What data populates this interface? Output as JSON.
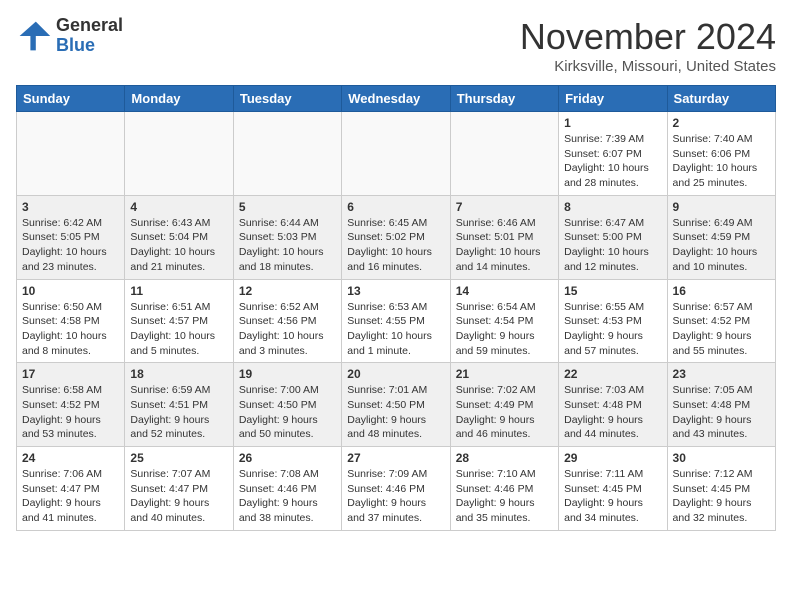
{
  "header": {
    "logo_general": "General",
    "logo_blue": "Blue",
    "month_title": "November 2024",
    "location": "Kirksville, Missouri, United States"
  },
  "weekdays": [
    "Sunday",
    "Monday",
    "Tuesday",
    "Wednesday",
    "Thursday",
    "Friday",
    "Saturday"
  ],
  "weeks": [
    [
      {
        "day": "",
        "info": ""
      },
      {
        "day": "",
        "info": ""
      },
      {
        "day": "",
        "info": ""
      },
      {
        "day": "",
        "info": ""
      },
      {
        "day": "",
        "info": ""
      },
      {
        "day": "1",
        "info": "Sunrise: 7:39 AM\nSunset: 6:07 PM\nDaylight: 10 hours\nand 28 minutes."
      },
      {
        "day": "2",
        "info": "Sunrise: 7:40 AM\nSunset: 6:06 PM\nDaylight: 10 hours\nand 25 minutes."
      }
    ],
    [
      {
        "day": "3",
        "info": "Sunrise: 6:42 AM\nSunset: 5:05 PM\nDaylight: 10 hours\nand 23 minutes."
      },
      {
        "day": "4",
        "info": "Sunrise: 6:43 AM\nSunset: 5:04 PM\nDaylight: 10 hours\nand 21 minutes."
      },
      {
        "day": "5",
        "info": "Sunrise: 6:44 AM\nSunset: 5:03 PM\nDaylight: 10 hours\nand 18 minutes."
      },
      {
        "day": "6",
        "info": "Sunrise: 6:45 AM\nSunset: 5:02 PM\nDaylight: 10 hours\nand 16 minutes."
      },
      {
        "day": "7",
        "info": "Sunrise: 6:46 AM\nSunset: 5:01 PM\nDaylight: 10 hours\nand 14 minutes."
      },
      {
        "day": "8",
        "info": "Sunrise: 6:47 AM\nSunset: 5:00 PM\nDaylight: 10 hours\nand 12 minutes."
      },
      {
        "day": "9",
        "info": "Sunrise: 6:49 AM\nSunset: 4:59 PM\nDaylight: 10 hours\nand 10 minutes."
      }
    ],
    [
      {
        "day": "10",
        "info": "Sunrise: 6:50 AM\nSunset: 4:58 PM\nDaylight: 10 hours\nand 8 minutes."
      },
      {
        "day": "11",
        "info": "Sunrise: 6:51 AM\nSunset: 4:57 PM\nDaylight: 10 hours\nand 5 minutes."
      },
      {
        "day": "12",
        "info": "Sunrise: 6:52 AM\nSunset: 4:56 PM\nDaylight: 10 hours\nand 3 minutes."
      },
      {
        "day": "13",
        "info": "Sunrise: 6:53 AM\nSunset: 4:55 PM\nDaylight: 10 hours\nand 1 minute."
      },
      {
        "day": "14",
        "info": "Sunrise: 6:54 AM\nSunset: 4:54 PM\nDaylight: 9 hours\nand 59 minutes."
      },
      {
        "day": "15",
        "info": "Sunrise: 6:55 AM\nSunset: 4:53 PM\nDaylight: 9 hours\nand 57 minutes."
      },
      {
        "day": "16",
        "info": "Sunrise: 6:57 AM\nSunset: 4:52 PM\nDaylight: 9 hours\nand 55 minutes."
      }
    ],
    [
      {
        "day": "17",
        "info": "Sunrise: 6:58 AM\nSunset: 4:52 PM\nDaylight: 9 hours\nand 53 minutes."
      },
      {
        "day": "18",
        "info": "Sunrise: 6:59 AM\nSunset: 4:51 PM\nDaylight: 9 hours\nand 52 minutes."
      },
      {
        "day": "19",
        "info": "Sunrise: 7:00 AM\nSunset: 4:50 PM\nDaylight: 9 hours\nand 50 minutes."
      },
      {
        "day": "20",
        "info": "Sunrise: 7:01 AM\nSunset: 4:50 PM\nDaylight: 9 hours\nand 48 minutes."
      },
      {
        "day": "21",
        "info": "Sunrise: 7:02 AM\nSunset: 4:49 PM\nDaylight: 9 hours\nand 46 minutes."
      },
      {
        "day": "22",
        "info": "Sunrise: 7:03 AM\nSunset: 4:48 PM\nDaylight: 9 hours\nand 44 minutes."
      },
      {
        "day": "23",
        "info": "Sunrise: 7:05 AM\nSunset: 4:48 PM\nDaylight: 9 hours\nand 43 minutes."
      }
    ],
    [
      {
        "day": "24",
        "info": "Sunrise: 7:06 AM\nSunset: 4:47 PM\nDaylight: 9 hours\nand 41 minutes."
      },
      {
        "day": "25",
        "info": "Sunrise: 7:07 AM\nSunset: 4:47 PM\nDaylight: 9 hours\nand 40 minutes."
      },
      {
        "day": "26",
        "info": "Sunrise: 7:08 AM\nSunset: 4:46 PM\nDaylight: 9 hours\nand 38 minutes."
      },
      {
        "day": "27",
        "info": "Sunrise: 7:09 AM\nSunset: 4:46 PM\nDaylight: 9 hours\nand 37 minutes."
      },
      {
        "day": "28",
        "info": "Sunrise: 7:10 AM\nSunset: 4:46 PM\nDaylight: 9 hours\nand 35 minutes."
      },
      {
        "day": "29",
        "info": "Sunrise: 7:11 AM\nSunset: 4:45 PM\nDaylight: 9 hours\nand 34 minutes."
      },
      {
        "day": "30",
        "info": "Sunrise: 7:12 AM\nSunset: 4:45 PM\nDaylight: 9 hours\nand 32 minutes."
      }
    ]
  ]
}
